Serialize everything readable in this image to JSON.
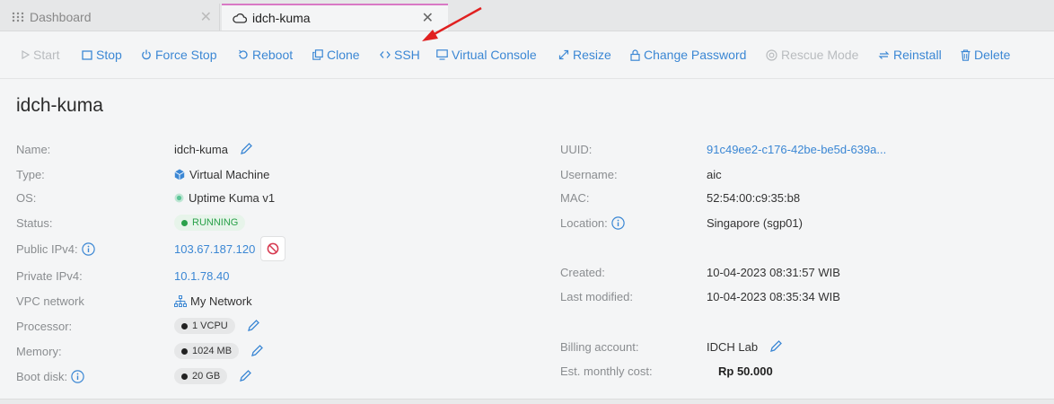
{
  "tabs": [
    {
      "label": "Dashboard",
      "icon": "grid-dots-icon"
    },
    {
      "label": "idch-kuma",
      "icon": "cloud-icon"
    }
  ],
  "toolbar": {
    "start": "Start",
    "stop": "Stop",
    "force_stop": "Force Stop",
    "reboot": "Reboot",
    "clone": "Clone",
    "ssh": "SSH",
    "virtual_console": "Virtual Console",
    "resize": "Resize",
    "change_password": "Change Password",
    "rescue_mode": "Rescue Mode",
    "reinstall": "Reinstall",
    "delete": "Delete"
  },
  "accent_color": "#3b87d4",
  "annotation_arrow_color": "#e02020",
  "page_title": "idch-kuma",
  "left": {
    "name_label": "Name:",
    "name_value": "idch-kuma",
    "type_label": "Type:",
    "type_value": "Virtual Machine",
    "os_label": "OS:",
    "os_value": "Uptime Kuma v1",
    "status_label": "Status:",
    "status_value": "RUNNING",
    "public_ipv4_label": "Public IPv4:",
    "public_ipv4_value": "103.67.187.120",
    "private_ipv4_label": "Private IPv4:",
    "private_ipv4_value": "10.1.78.40",
    "vpc_label": "VPC network",
    "vpc_value": "My Network",
    "processor_label": "Processor:",
    "processor_value": "1 VCPU",
    "memory_label": "Memory:",
    "memory_value": "1024 MB",
    "boot_disk_label": "Boot disk:",
    "boot_disk_value": "20 GB"
  },
  "right": {
    "uuid_label": "UUID:",
    "uuid_value": "91c49ee2-c176-42be-be5d-639a...",
    "username_label": "Username:",
    "username_value": "aic",
    "mac_label": "MAC:",
    "mac_value": "52:54:00:c9:35:b8",
    "location_label": "Location:",
    "location_value": "Singapore (sgp01)",
    "created_label": "Created:",
    "created_value": "10-04-2023 08:31:57 WIB",
    "modified_label": "Last modified:",
    "modified_value": "10-04-2023 08:35:34 WIB",
    "billing_label": "Billing account:",
    "billing_value": "IDCH Lab",
    "cost_label": "Est. monthly cost:",
    "cost_value": "Rp 50.000"
  }
}
